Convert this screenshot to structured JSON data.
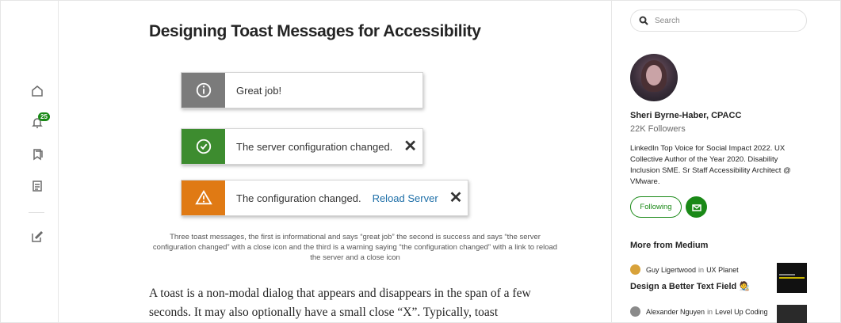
{
  "nav": {
    "notifications_count": "25"
  },
  "article": {
    "title": "Designing Toast Messages for Accessibility",
    "toasts": [
      {
        "text": "Great job!",
        "color": "#7b7b7b",
        "icon": "info-icon"
      },
      {
        "text": "The server configuration changed.",
        "color": "#3d8c2f",
        "icon": "check-circle-icon",
        "close": "✕"
      },
      {
        "text": "The configuration changed.",
        "link": "Reload Server",
        "color": "#e07a14",
        "icon": "warning-icon",
        "close": "✕"
      }
    ],
    "caption": "Three toast messages, the first is informational and says “great job” the second is success and says “the server configuration changed” with a close icon and the third is a warning saying “the configuration changed” with a link to reload the server and a close icon",
    "body": "A toast is a non-modal dialog that appears and disappears in the span of a few seconds. It may also optionally have a small close “X”. Typically, toast"
  },
  "sidebar": {
    "search_placeholder": "Search",
    "author": {
      "name": "Sheri Byrne-Haber, CPACC",
      "followers": "22K Followers",
      "bio": "LinkedIn Top Voice for Social Impact 2022. UX Collective Author of the Year 2020. Disability Inclusion SME. Sr Staff Accessibility Architect @ VMware."
    },
    "follow_label": "Following",
    "more_heading": "More from Medium",
    "recommendations": [
      {
        "author": "Guy Ligertwood",
        "in": "in",
        "publication": "UX Planet",
        "title": "Design a Better Text Field 🧑‍🎨"
      },
      {
        "author": "Alexander Nguyen",
        "in": "in",
        "publication": "Level Up Coding",
        "title": ""
      }
    ]
  }
}
